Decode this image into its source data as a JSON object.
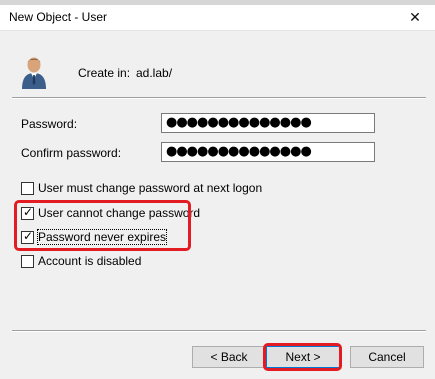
{
  "window": {
    "title": "New Object - User",
    "close_glyph": "✕"
  },
  "header": {
    "icon": "user-avatar-icon",
    "create_in_label": "Create in:",
    "create_in_value": "ad.lab/"
  },
  "form": {
    "password_label": "Password:",
    "password_value": "●●●●●●●●●●●●●●",
    "confirm_label": "Confirm password:",
    "confirm_value": "●●●●●●●●●●●●●●"
  },
  "options": [
    {
      "label": "User must change password at next logon",
      "checked": false
    },
    {
      "label": "User cannot change password",
      "checked": true
    },
    {
      "label": "Password never expires",
      "checked": true
    },
    {
      "label": "Account is disabled",
      "checked": false
    }
  ],
  "buttons": {
    "back": "< Back",
    "next": "Next >",
    "cancel": "Cancel"
  },
  "colors": {
    "highlight": "#e31b23",
    "accent": "#0078d7"
  }
}
